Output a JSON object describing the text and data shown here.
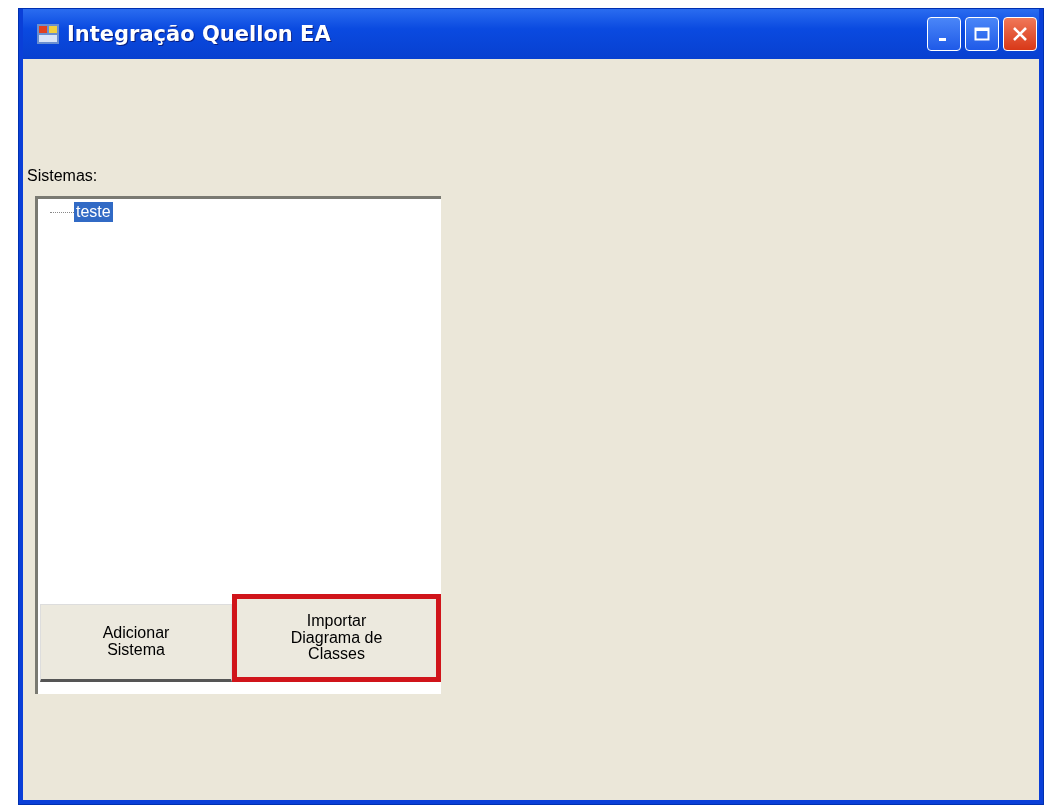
{
  "window": {
    "title": "Integração Quellon EA"
  },
  "systems_label": "Sistemas:",
  "tree": {
    "items": [
      {
        "label": "teste",
        "selected": true
      }
    ]
  },
  "buttons": [
    {
      "label": "Adicionar\nSistema",
      "highlighted": false
    },
    {
      "label": "Importar\nDiagrama de\nClasses",
      "highlighted": true
    }
  ]
}
